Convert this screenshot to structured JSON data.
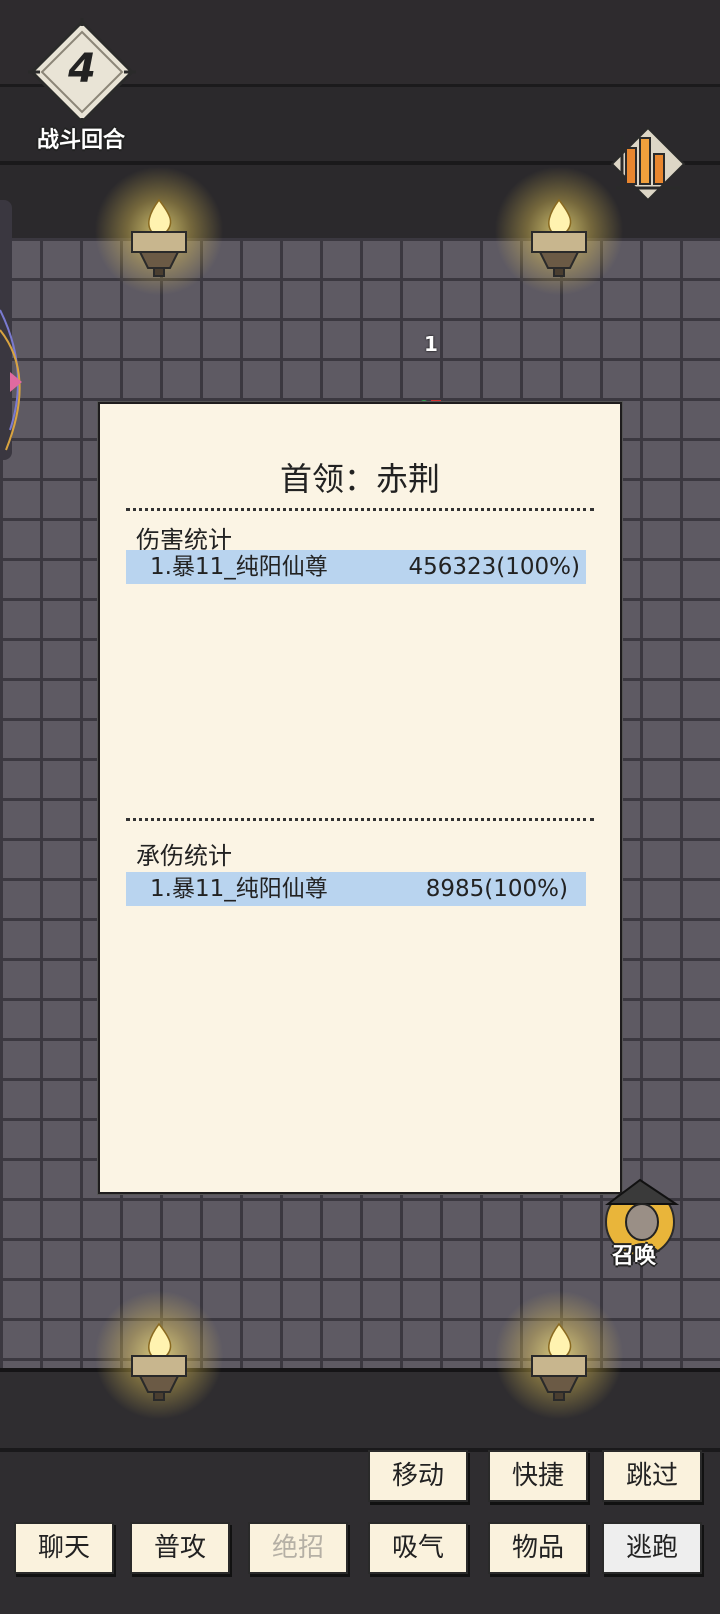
{
  "hud": {
    "round_number": "4",
    "round_label": "战斗回合",
    "damage_popup": "1"
  },
  "panel": {
    "title": "首领：赤荆",
    "damage_section": {
      "title": "伤害统计",
      "rows": [
        {
          "name": "1.暴11_纯阳仙尊",
          "value": "456323(100%)"
        }
      ]
    },
    "taken_section": {
      "title": "承伤统计",
      "rows": [
        {
          "name": "1.暴11_纯阳仙尊",
          "value": "8985(100%)"
        }
      ]
    }
  },
  "summon": {
    "label": "召唤"
  },
  "actions": {
    "row1": [
      {
        "label": "移动",
        "enabled": true
      },
      {
        "label": "快捷",
        "enabled": true
      },
      {
        "label": "跳过",
        "enabled": true
      }
    ],
    "row2": [
      {
        "label": "聊天",
        "enabled": true
      },
      {
        "label": "普攻",
        "enabled": true
      },
      {
        "label": "绝招",
        "enabled": false
      },
      {
        "label": "吸气",
        "enabled": true
      },
      {
        "label": "物品",
        "enabled": true
      },
      {
        "label": "逃跑",
        "enabled": true
      }
    ]
  },
  "colors": {
    "panel_bg": "#fbf4e4",
    "row_highlight": "#b9d4ef",
    "button_bg": "#faf2dd",
    "wall": "#5e5a63"
  },
  "icons": [
    "round-badge-icon",
    "stats-chart-icon",
    "torch-icon",
    "summon-avatar-icon"
  ]
}
